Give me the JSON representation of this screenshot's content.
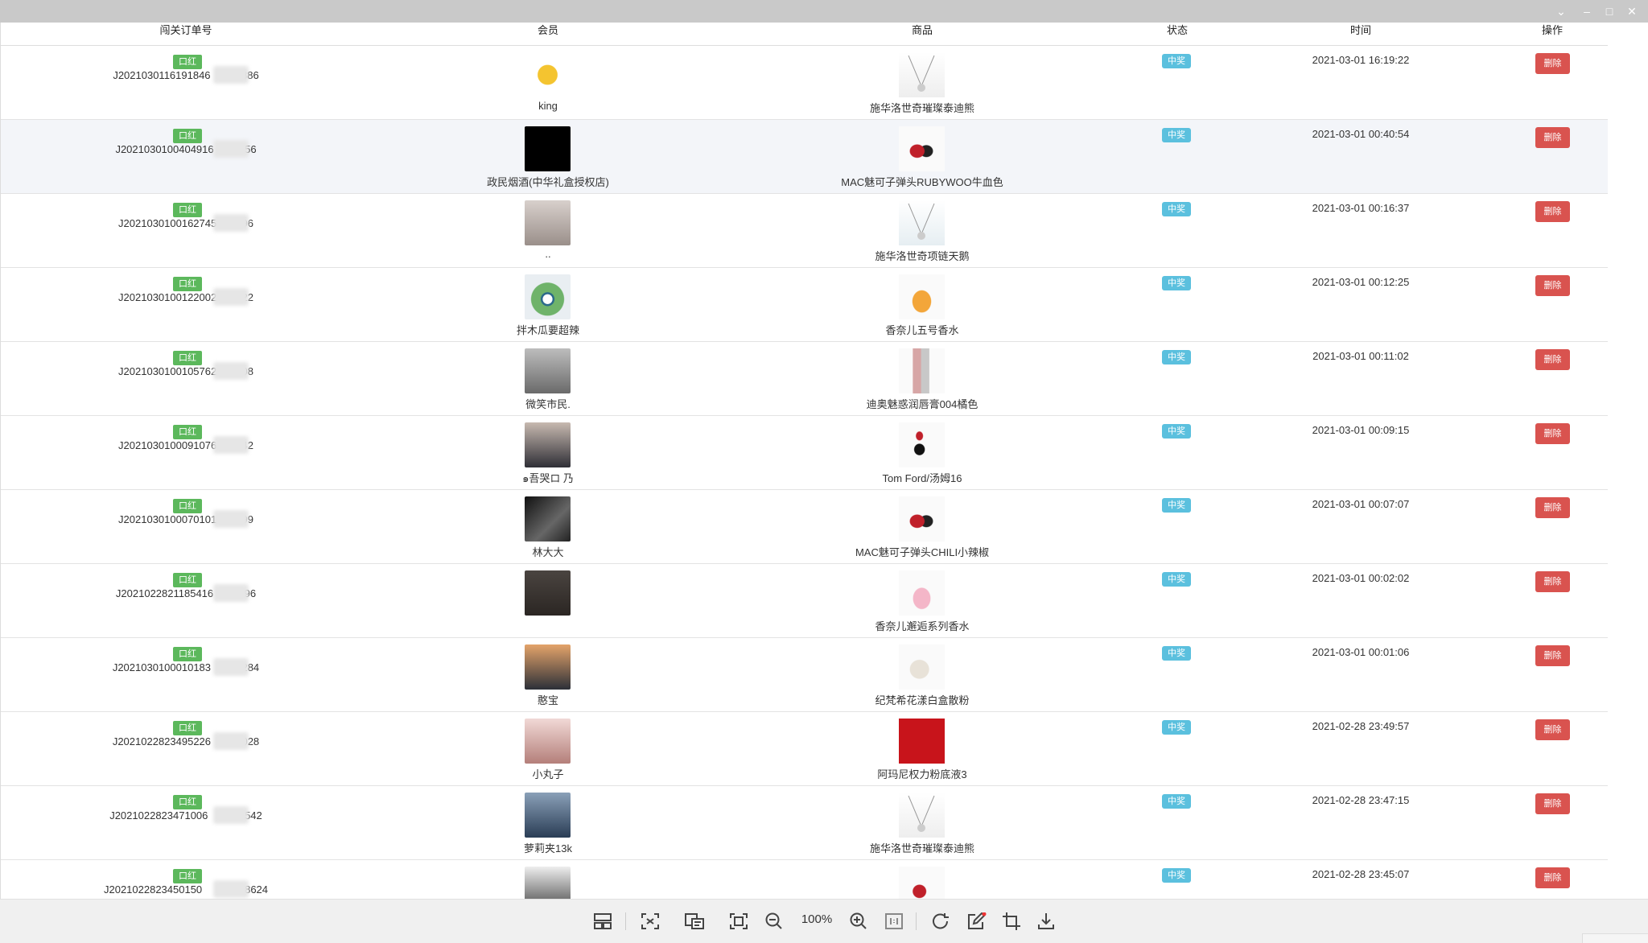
{
  "header": {
    "order_col": "闯关订单号",
    "member_col": "会员",
    "product_col": "商品",
    "status_col": "状态",
    "time_col": "时间",
    "action_col": "操作"
  },
  "colors": {
    "tag": "#5cb85c",
    "status": "#5bc0de",
    "delete": "#d9534f"
  },
  "rows": [
    {
      "tag": "口红",
      "order": "J2021030116191846",
      "order_tail": "56886",
      "member": "king",
      "product": "施华洛世奇璀璨泰迪熊",
      "status": "中奖",
      "time": "2021-03-01 16:19:22",
      "delete": "删除"
    },
    {
      "tag": "口红",
      "order": "J2021030100404916",
      "order_tail": "4356",
      "member": "政民烟酒(中华礼盒授权店)",
      "product": "MAC魅可子弹头RUBYWOO牛血色",
      "status": "中奖",
      "time": "2021-03-01 00:40:54",
      "delete": "删除"
    },
    {
      "tag": "口红",
      "order": "J2021030100162745",
      "order_tail": "796",
      "member": "..",
      "product": "施华洛世奇项链天鹅",
      "status": "中奖",
      "time": "2021-03-01 00:16:37",
      "delete": "删除"
    },
    {
      "tag": "口红",
      "order": "J2021030100122002",
      "order_tail": "222",
      "member": "拌木瓜要超辣",
      "product": "香奈儿五号香水",
      "status": "中奖",
      "time": "2021-03-01 00:12:25",
      "delete": "删除"
    },
    {
      "tag": "口红",
      "order": "J2021030100105762",
      "order_tail": "508",
      "member": "微笑市民.",
      "product": "迪奥魅惑润唇膏004橘色",
      "status": "中奖",
      "time": "2021-03-01 00:11:02",
      "delete": "删除"
    },
    {
      "tag": "口红",
      "order": "J2021030100091076",
      "order_tail": "342",
      "member": "๑吾哭ロ 乃",
      "product": "Tom Ford/汤姆16",
      "status": "中奖",
      "time": "2021-03-01 00:09:15",
      "delete": "删除"
    },
    {
      "tag": "口红",
      "order": "J2021030100070101",
      "order_tail": "899",
      "member": "林大大",
      "product": "MAC魅可子弹头CHILI小辣椒",
      "status": "中奖",
      "time": "2021-03-01 00:07:07",
      "delete": "删除"
    },
    {
      "tag": "口红",
      "order": "J2021022821185416",
      "order_tail": "2596",
      "member": "",
      "product": "香奈儿邂逅系列香水",
      "status": "中奖",
      "time": "2021-03-01 00:02:02",
      "delete": "删除"
    },
    {
      "tag": "口红",
      "order": "J2021030100010183",
      "order_tail": "32284",
      "member": "憨宝",
      "product": "纪梵希花漾白盒散粉",
      "status": "中奖",
      "time": "2021-03-01 00:01:06",
      "delete": "删除"
    },
    {
      "tag": "口红",
      "order": "J2021022823495226",
      "order_tail": "83028",
      "member": "小丸子",
      "product": "阿玛尼权力粉底液3",
      "status": "中奖",
      "time": "2021-02-28 23:49:57",
      "delete": "删除"
    },
    {
      "tag": "口红",
      "order": "J2021022823471006",
      "order_tail": "216542",
      "member": "萝莉夹13k",
      "product": "施华洛世奇璀璨泰迪熊",
      "status": "中奖",
      "time": "2021-02-28 23:47:15",
      "delete": "删除"
    },
    {
      "tag": "口红",
      "order": "J2021022823450150",
      "order_tail": "80988624",
      "member": "",
      "product": "",
      "status": "中奖",
      "time": "2021-02-28 23:45:07",
      "delete": "删除"
    }
  ],
  "toolbar": {
    "zoom": "100%"
  }
}
